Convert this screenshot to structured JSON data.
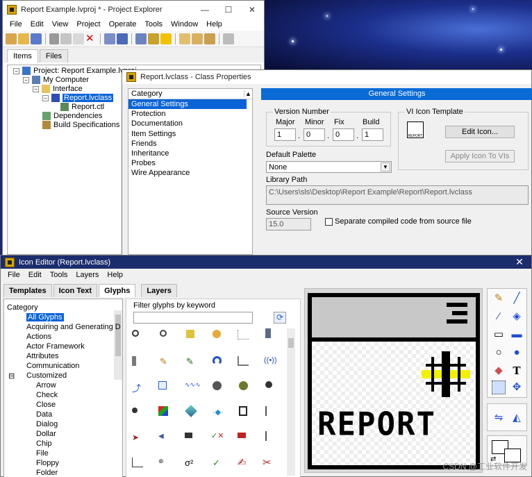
{
  "project_explorer": {
    "title": "Report Example.lvproj * - Project Explorer",
    "menu": [
      "File",
      "Edit",
      "View",
      "Project",
      "Operate",
      "Tools",
      "Window",
      "Help"
    ],
    "tabs": [
      "Items",
      "Files"
    ],
    "tree": {
      "project": "Project: Report Example.lvproj",
      "computer": "My Computer",
      "interface": "Interface",
      "class": "Report.lvclass",
      "ctl": "Report.ctl",
      "dependencies": "Dependencies",
      "build": "Build Specifications"
    }
  },
  "class_properties": {
    "title": "Report.lvclass - Class Properties",
    "category_header": "Category",
    "categories": [
      "General Settings",
      "Protection",
      "Documentation",
      "Item Settings",
      "Friends",
      "Inheritance",
      "Probes",
      "Wire Appearance"
    ],
    "section_title": "General Settings",
    "version_number": {
      "label": "Version Number",
      "major_label": "Major",
      "minor_label": "Minor",
      "fix_label": "Fix",
      "build_label": "Build",
      "major": "1",
      "minor": "0",
      "fix": "0",
      "build": "1"
    },
    "vi_icon_template": {
      "label": "VI Icon Template",
      "edit_button": "Edit Icon...",
      "apply_button": "Apply Icon To VIs",
      "thumb_text": "REPORT"
    },
    "default_palette_label": "Default Palette",
    "default_palette_value": "None",
    "library_path_label": "Library Path",
    "library_path": "C:\\Users\\sls\\Desktop\\Report Example\\Report\\Report.lvclass",
    "source_version_label": "Source Version",
    "source_version": "15.0",
    "separate_compiled_label": "Separate compiled code from source file"
  },
  "icon_editor": {
    "title": "Icon Editor (Report.lvclass)",
    "menu": [
      "File",
      "Edit",
      "Tools",
      "Layers",
      "Help"
    ],
    "tabs": [
      "Templates",
      "Icon Text",
      "Glyphs",
      "Layers"
    ],
    "category_header": "Category",
    "categories": [
      "All Glyphs",
      "Acquiring and Generating D",
      "Actions",
      "Actor Framework",
      "Attributes",
      "Communication",
      "Customized",
      "Arrow",
      "Check",
      "Close",
      "Data",
      "Dialog",
      "Dollar",
      "Chip",
      "File",
      "Floppy",
      "Folder"
    ],
    "filter_label": "Filter glyphs by keyword",
    "canvas_text": "REPORT",
    "close_glyph": "✕"
  },
  "watermark": "CSDN @工业软件开发",
  "colors": {
    "selection": "#0a64d8",
    "section_bar": "#0a6ad6",
    "icon_editor_titlebar": "#1c2d6e",
    "icon_accent": "#f2f200"
  }
}
